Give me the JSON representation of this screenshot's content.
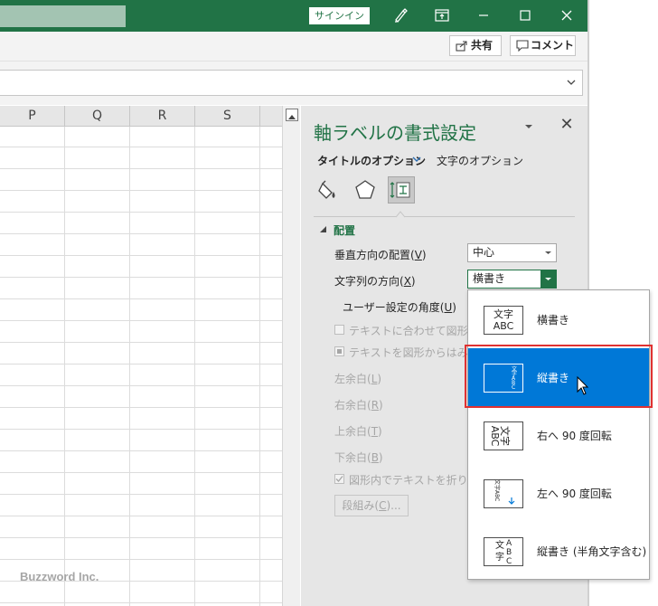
{
  "titlebar": {
    "signin_label": "サインイン",
    "bg": "#217346"
  },
  "ribbon": {
    "share_label": "共有",
    "comment_label": "コメント"
  },
  "sheet": {
    "columns": [
      "P",
      "Q",
      "R",
      "S"
    ]
  },
  "pane": {
    "title": "軸ラベルの書式設定",
    "tab_title_options": "タイトルのオプション",
    "tab_text_options": "文字のオプション",
    "section_label": "配置",
    "vertical_alignment_label": "垂直方向の配置(",
    "vertical_alignment_key": "V",
    "vertical_alignment_value": "中心",
    "text_direction_label": "文字列の方向(",
    "text_direction_key": "X",
    "text_direction_value": "横書き",
    "custom_angle_label": "ユーザー設定の角度(",
    "custom_angle_key": "U",
    "resize_shape_label": "テキストに合わせて図形のサ",
    "overflow_label": "テキストを図形からはみ出し",
    "left_margin_label": "左余白(",
    "left_margin_key": "L",
    "right_margin_label": "右余白(",
    "right_margin_key": "R",
    "top_margin_label": "上余白(",
    "top_margin_key": "T",
    "bottom_margin_label": "下余白(",
    "bottom_margin_key": "B",
    "wrap_text_label": "図形内でテキストを折り返す",
    "columns_label": "段組み(",
    "columns_key": "C",
    "columns_suffix": ")...",
    "close_paren": ")"
  },
  "dropdown": {
    "options": [
      {
        "label": "横書き",
        "thumb": [
          "文字",
          "ABC"
        ]
      },
      {
        "label": "縦書き",
        "thumb": [
          "文字ABC"
        ]
      },
      {
        "label": "右へ 90 度回転",
        "thumb": [
          "文字",
          "ABC"
        ]
      },
      {
        "label": "左へ 90 度回転",
        "thumb": [
          "文字ABC"
        ]
      },
      {
        "label": "縦書き (半角文字含む)",
        "thumb": [
          "文字",
          "ABC"
        ]
      }
    ],
    "selected_index": 1,
    "highlight_color": "#0078d7"
  },
  "watermark": "Buzzword Inc."
}
